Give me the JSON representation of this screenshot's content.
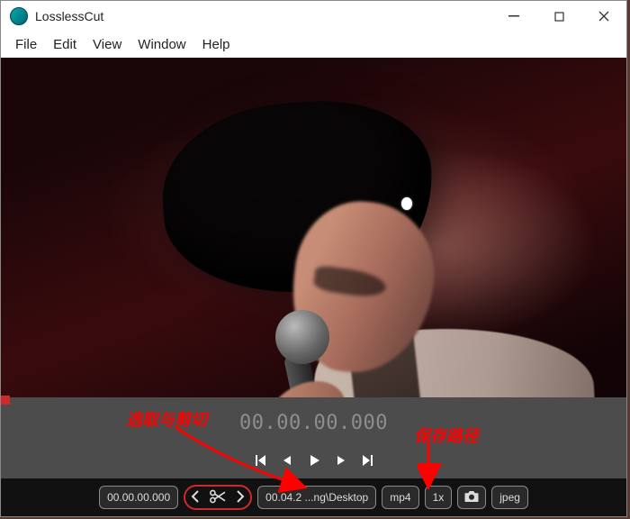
{
  "window": {
    "title": "LosslessCut"
  },
  "menu": {
    "file": "File",
    "edit": "Edit",
    "view": "View",
    "window": "Window",
    "help": "Help"
  },
  "timeline": {
    "current_time": "00.00.00.000"
  },
  "footer": {
    "start_time": "00.00.00.000",
    "end_path": "00.04.2 ...ng\\Desktop",
    "format": "mp4",
    "speed": "1x",
    "capture_format": "jpeg"
  },
  "annotations": {
    "cut": "选取与剪切",
    "save_path": "保存路径"
  }
}
